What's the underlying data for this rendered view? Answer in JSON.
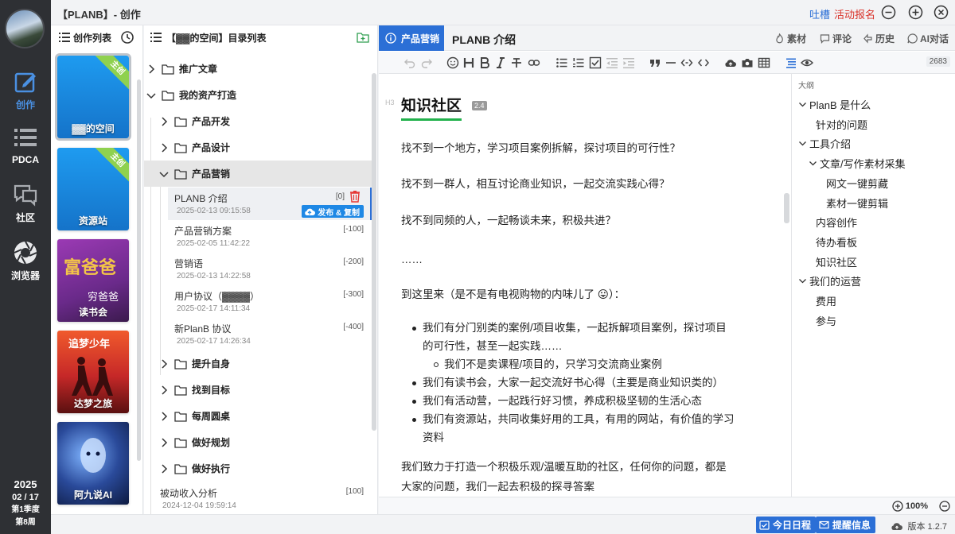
{
  "app": {
    "title": "【PLANB】- 创作",
    "complain": "吐槽",
    "signup": "活动报名"
  },
  "colors": {
    "accent": "#2b6fd6",
    "signup": "#d9342b",
    "ribbon": "#8fd14f",
    "heading_underline": "#22b14c",
    "trash": "#e53935"
  },
  "rail": {
    "nav": [
      {
        "label": "创作",
        "icon": "edit-icon",
        "active": true
      },
      {
        "label": "PDCA",
        "icon": "list-icon"
      },
      {
        "label": "社区",
        "icon": "chat-icon"
      },
      {
        "label": "浏览器",
        "icon": "aperture-icon"
      }
    ],
    "date": {
      "year": "2025",
      "day": "02 / 17",
      "quarter": "第1季度",
      "week": "第8周"
    }
  },
  "works": {
    "header": "创作列表",
    "cards": [
      {
        "name": "▓▓的空间",
        "badge": "主创",
        "style": "blue"
      },
      {
        "name": "资源站",
        "badge": "主创",
        "style": "blue"
      },
      {
        "name": "读书会",
        "badge": "",
        "style": "book",
        "art": "富爸爸",
        "art2": "穷爸爸"
      },
      {
        "name": "达梦之旅",
        "badge": "",
        "style": "dream",
        "art": "追梦少年"
      },
      {
        "name": "阿九说AI",
        "badge": "",
        "style": "ai"
      }
    ]
  },
  "catalog": {
    "header": "【▓▓的空间】目录列表",
    "items": [
      {
        "label": "推广文章",
        "expanded": false
      },
      {
        "label": "我的资产打造",
        "expanded": true
      },
      {
        "label": "产品开发",
        "expanded": false
      },
      {
        "label": "产品设计",
        "expanded": false
      },
      {
        "label": "产品营销",
        "expanded": true
      },
      {
        "label": "提升自身",
        "expanded": false
      },
      {
        "label": "找到目标",
        "expanded": false
      },
      {
        "label": "每周圆桌",
        "expanded": false
      },
      {
        "label": "做好规划",
        "expanded": false
      },
      {
        "label": "做好执行",
        "expanded": false
      }
    ],
    "docs": [
      {
        "title": "PLANB 介绍",
        "count": "[0]",
        "date": "2025-02-13 09:15:58"
      },
      {
        "title": "产品营销方案",
        "count": "[-100]",
        "date": "2025-02-05 11:42:22"
      },
      {
        "title": "营销语",
        "count": "[-200]",
        "date": "2025-02-13 14:22:58"
      },
      {
        "title": "用户协议（▓▓▓▓）",
        "count": "[-300]",
        "date": "2025-02-17 14:11:34"
      },
      {
        "title": "新PlanB 协议",
        "count": "[-400]",
        "date": "2025-02-17 14:26:34"
      },
      {
        "title": "被动收入分析",
        "count": "[100]",
        "date": "2024-12-04 19:59:14"
      }
    ],
    "publish_label": "发布 & 复制"
  },
  "editor": {
    "category": "产品营销",
    "doc_title": "PLANB 介绍",
    "actions": [
      "素材",
      "评论",
      "历史",
      "AI对话"
    ],
    "word_count": "2683",
    "heading_tag": "H3",
    "heading": "知识社区",
    "heading_version": "2.4",
    "paragraphs": [
      "找不到一个地方，学习项目案例拆解，探讨项目的可行性？",
      "找不到一群人，相互讨论商业知识，一起交流实践心得？",
      "找不到同频的人，一起畅谈未来，积极共进？",
      "……",
      "到这里来（是不是有电视购物的内味儿了 😛）："
    ],
    "bullets": [
      "我们有分门别类的案例/项目收集，一起拆解项目案例，探讨项目",
      "的可行性，甚至一起实践……",
      "我们不是卖课程/项目的，只学习交流商业案例",
      "我们有读书会，大家一起交流好书心得（主要是商业知识类的）",
      "我们有活动营，一起践行好习惯，养成积极坚韧的生活心态",
      "我们有资源站，共同收集好用的工具，有用的网站，有价值的学习",
      "资料"
    ],
    "closing": [
      "我们致力于打造一个积极乐观/温暖互助的社区，任何你的问题，都是",
      "大家的问题，我们一起去积极的探寻答案"
    ],
    "zoom": "100%"
  },
  "outline": {
    "header": "大纲",
    "items": [
      {
        "label": "PlanB 是什么",
        "level": 1,
        "expand": true
      },
      {
        "label": "针对的问题",
        "level": 2,
        "expand": false
      },
      {
        "label": "工具介绍",
        "level": 1,
        "expand": true
      },
      {
        "label": "文章/写作素材采集",
        "level": 2,
        "expand": true
      },
      {
        "label": "网文一键剪藏",
        "level": 3,
        "expand": false
      },
      {
        "label": "素材一键剪辑",
        "level": 3,
        "expand": false
      },
      {
        "label": "内容创作",
        "level": 2,
        "expand": false
      },
      {
        "label": "待办看板",
        "level": 2,
        "expand": false
      },
      {
        "label": "知识社区",
        "level": 2,
        "expand": false
      },
      {
        "label": "我们的运营",
        "level": 1,
        "expand": true
      },
      {
        "label": "费用",
        "level": 2,
        "expand": false
      },
      {
        "label": "参与",
        "level": 2,
        "expand": false
      }
    ]
  },
  "bottom": {
    "schedule": "今日日程",
    "reminder": "提醒信息",
    "version": "版本 1.2.7"
  }
}
